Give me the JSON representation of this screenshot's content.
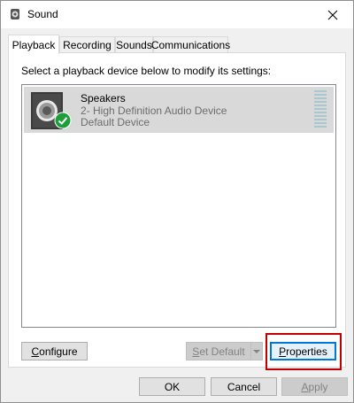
{
  "window": {
    "title": "Sound",
    "icons": {
      "app": "speaker-app-icon",
      "close": "close-icon"
    }
  },
  "tabs": [
    {
      "label": "Playback",
      "active": true
    },
    {
      "label": "Recording",
      "active": false
    },
    {
      "label": "Sounds",
      "active": false
    },
    {
      "label": "Communications",
      "active": false
    }
  ],
  "panel": {
    "instruction": "Select a playback device below to modify its settings:",
    "devices": [
      {
        "name": "Speakers",
        "description": "2- High Definition Audio Device",
        "status": "Default Device",
        "icon": "speaker-device-icon",
        "badge": "default-check-icon",
        "selected": true
      }
    ],
    "buttons": {
      "configure": "Configure",
      "set_default": "Set Default",
      "properties": "Properties"
    }
  },
  "footer": {
    "ok": "OK",
    "cancel": "Cancel",
    "apply": "Apply"
  },
  "colors": {
    "selection": "#d9d9d9",
    "highlight_box": "#c00000",
    "focus_border": "#0078d7"
  }
}
